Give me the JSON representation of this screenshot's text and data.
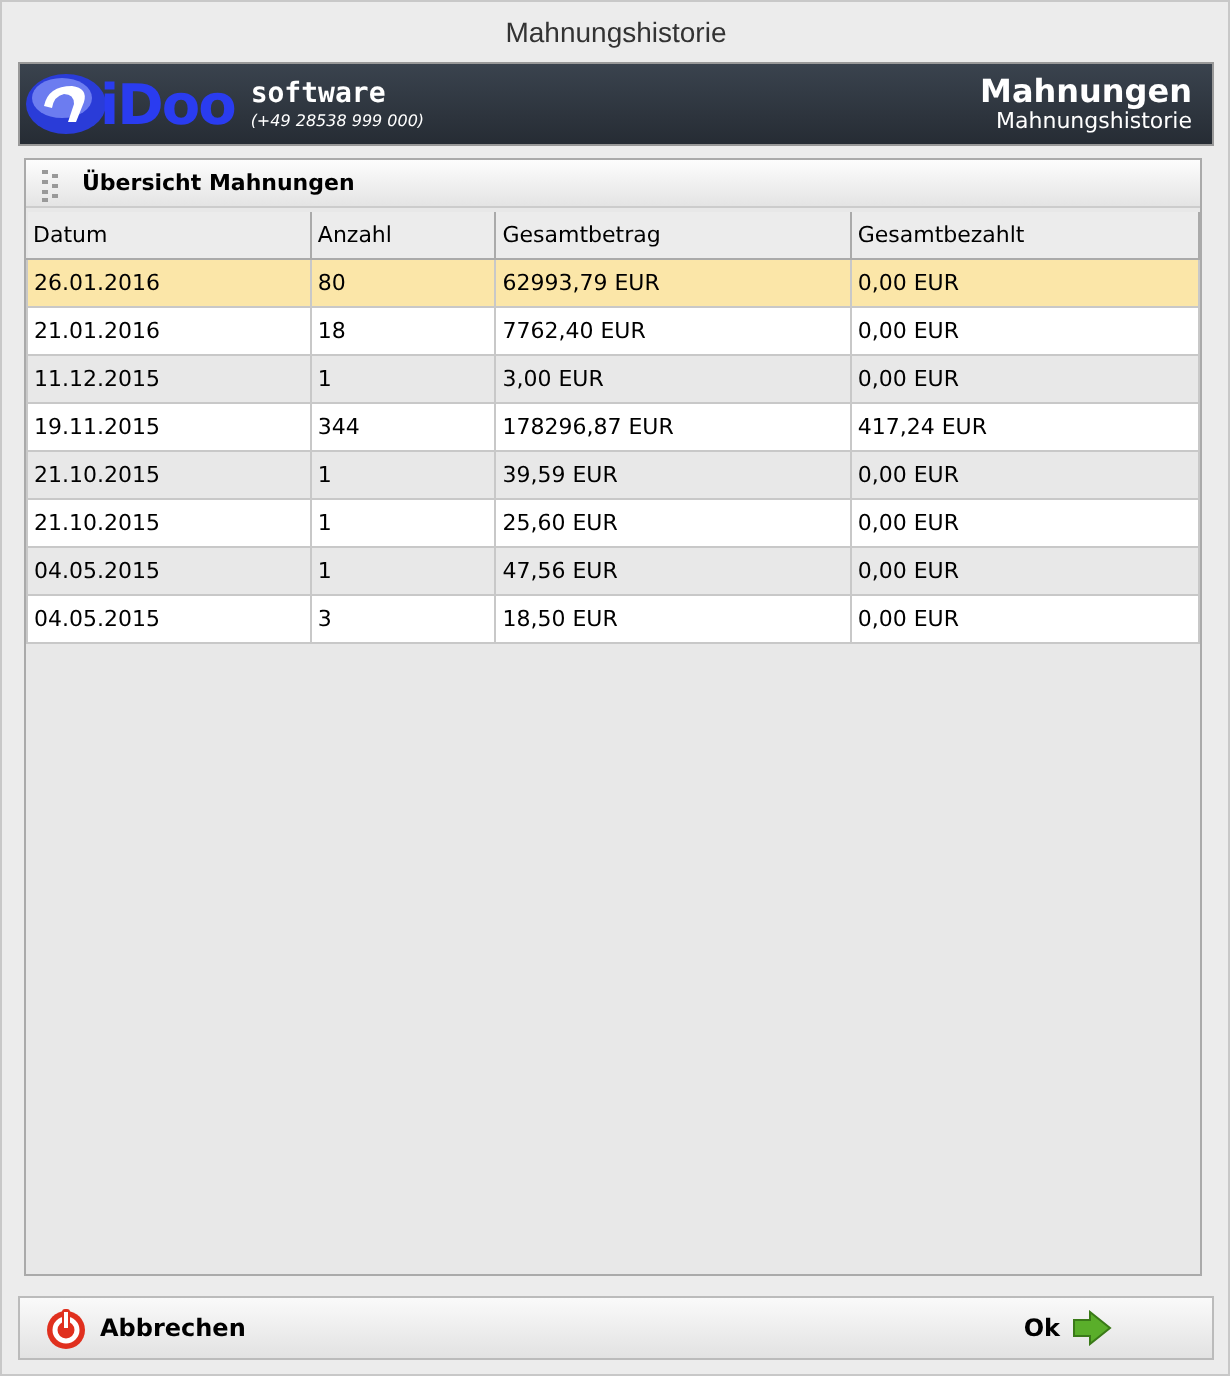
{
  "window": {
    "title": "Mahnungshistorie"
  },
  "banner": {
    "logo_text": "iDoo",
    "brand": "software",
    "phone": "(+49 28538 999 000)",
    "title": "Mahnungen",
    "subtitle": "Mahnungshistorie"
  },
  "panel": {
    "title": "Übersicht Mahnungen"
  },
  "table": {
    "columns": [
      "Datum",
      "Anzahl",
      "Gesamtbetrag",
      "Gesamtbezahlt"
    ],
    "rows": [
      {
        "cells": [
          "26.01.2016",
          "80",
          "62993,79 EUR",
          "0,00 EUR"
        ],
        "selected": true
      },
      {
        "cells": [
          "21.01.2016",
          "18",
          "7762,40 EUR",
          "0,00 EUR"
        ],
        "selected": false
      },
      {
        "cells": [
          "11.12.2015",
          "1",
          "3,00 EUR",
          "0,00 EUR"
        ],
        "selected": false
      },
      {
        "cells": [
          "19.11.2015",
          "344",
          "178296,87 EUR",
          "417,24 EUR"
        ],
        "selected": false
      },
      {
        "cells": [
          "21.10.2015",
          "1",
          "39,59 EUR",
          "0,00 EUR"
        ],
        "selected": false
      },
      {
        "cells": [
          "21.10.2015",
          "1",
          "25,60 EUR",
          "0,00 EUR"
        ],
        "selected": false
      },
      {
        "cells": [
          "04.05.2015",
          "1",
          "47,56 EUR",
          "0,00 EUR"
        ],
        "selected": false
      },
      {
        "cells": [
          "04.05.2015",
          "3",
          "18,50 EUR",
          "0,00 EUR"
        ],
        "selected": false
      }
    ]
  },
  "footer": {
    "buttons": [
      {
        "label": "Abbrechen",
        "kind": "cancel"
      },
      {
        "label": "Ok",
        "kind": "ok"
      }
    ]
  }
}
